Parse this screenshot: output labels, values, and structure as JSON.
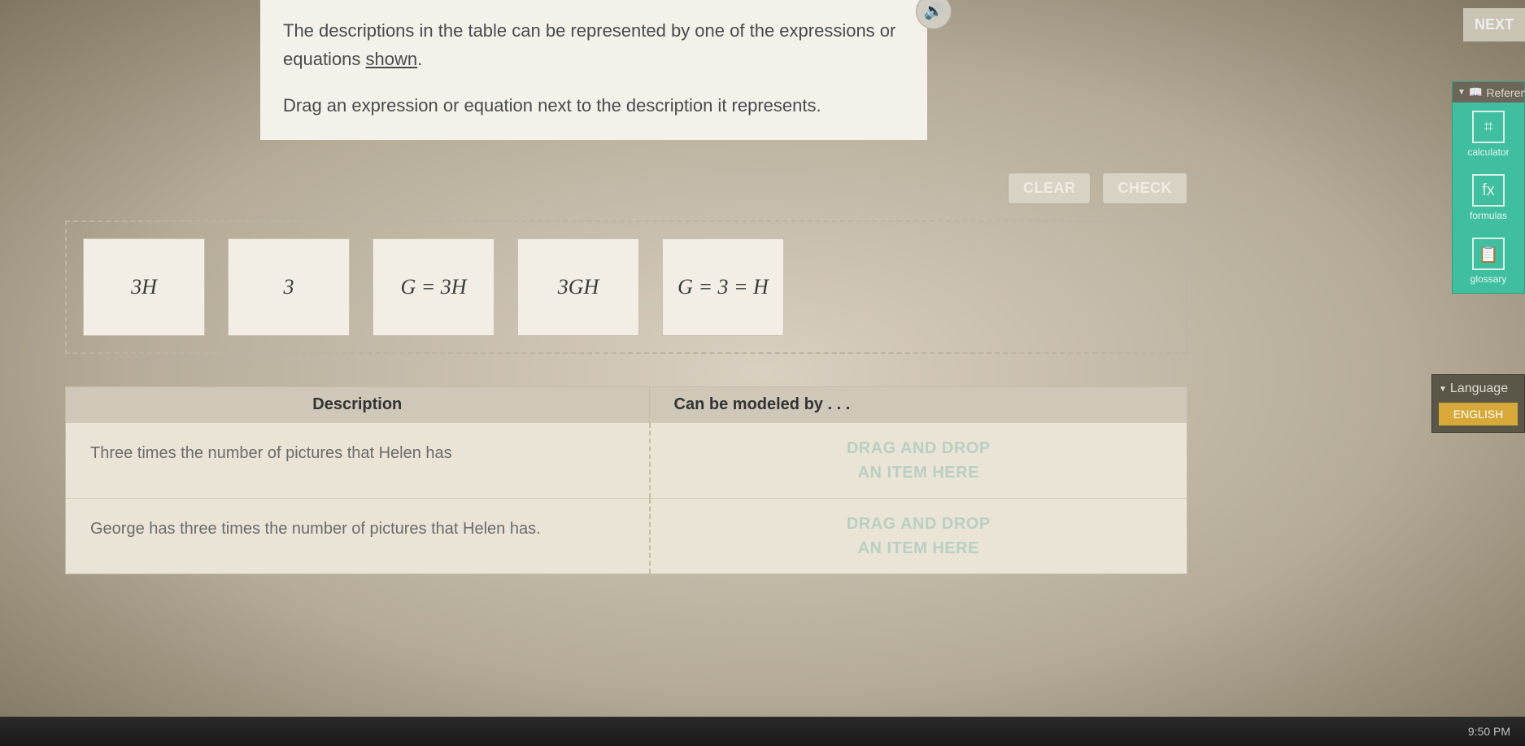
{
  "prompt": {
    "line1_a": "The descriptions in the table can be represented by one of the expressions or equations ",
    "line1_link": "shown",
    "line1_b": ".",
    "line2": "Drag an expression or equation next to the description it represents."
  },
  "buttons": {
    "clear": "CLEAR",
    "check": "CHECK",
    "next": "NEXT"
  },
  "tiles": [
    "3H",
    "3",
    "G = 3H",
    "3GH",
    "G = 3 = H"
  ],
  "table": {
    "header_desc": "Description",
    "header_model": "Can be modeled by . . .",
    "rows": [
      {
        "desc": "Three times the number of pictures that Helen has"
      },
      {
        "desc": "George has three times the number of pictures that Helen has."
      }
    ],
    "drop_line1": "DRAG AND DROP",
    "drop_line2": "AN ITEM HERE"
  },
  "reference": {
    "header": "Reference",
    "items": [
      {
        "label": "calculator",
        "glyph": "⌗"
      },
      {
        "label": "formulas",
        "glyph": "fx"
      },
      {
        "label": "glossary",
        "glyph": "📋"
      }
    ]
  },
  "language": {
    "header": "Language",
    "button": "ENGLISH"
  },
  "taskbar": {
    "time": "9:50 PM"
  },
  "icons": {
    "triangle": "▼",
    "speaker": "🔊",
    "book": "📖"
  }
}
